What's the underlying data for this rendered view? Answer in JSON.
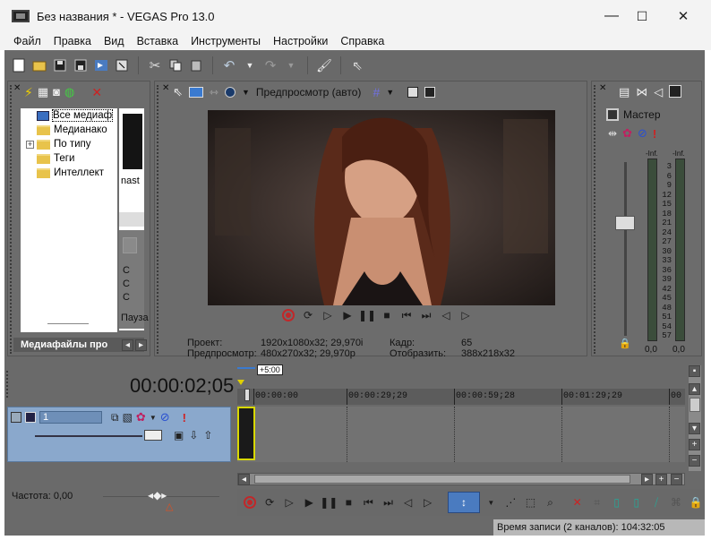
{
  "window": {
    "title": "Без названия * - VEGAS Pro 13.0",
    "minimize": "—",
    "maximize": "☐",
    "close": "✕"
  },
  "menu": [
    "Файл",
    "Правка",
    "Вид",
    "Вставка",
    "Инструменты",
    "Настройки",
    "Справка"
  ],
  "explorer": {
    "items": [
      {
        "label": "Все медиаф",
        "selected": true
      },
      {
        "label": "Медианако"
      },
      {
        "label": "По типу",
        "expander": "+"
      },
      {
        "label": "Теги"
      },
      {
        "label": "Интеллект"
      }
    ],
    "thumb_name": "nast",
    "pause_label": "Пауза",
    "tab_label": "Медиафайлы про",
    "mark_c": [
      "С",
      "С",
      "С"
    ]
  },
  "preview": {
    "mode_label": "Предпросмотр (авто)",
    "project_label": "Проект:",
    "project_value": "1920x1080x32; 29,970i",
    "preview_label": "Предпросмотр:",
    "preview_value": "480x270x32; 29,970p",
    "frame_label": "Кадр:",
    "frame_value": "65",
    "display_label": "Отобразить:",
    "display_value": "388x218x32"
  },
  "master": {
    "label": "Мастер",
    "scale": [
      "3",
      "6",
      "9",
      "12",
      "15",
      "18",
      "21",
      "24",
      "27",
      "30",
      "33",
      "36",
      "39",
      "42",
      "45",
      "48",
      "51",
      "54",
      "57"
    ],
    "peak_left": "-Inf.",
    "peak_right": "-Inf.",
    "level_left": "0,0",
    "level_right": "0,0"
  },
  "timeline": {
    "timecode": "00:00:02;05",
    "track_number": "1",
    "region_label": "+5:00",
    "ruler": [
      "00:00:00",
      "00:00:29;29",
      "00:00:59;28",
      "00:01:29;29",
      "00"
    ],
    "rate_label": "Частота: 0,00",
    "status": "Время записи (2 каналов): 104:32:05"
  },
  "colors": {
    "app_bg": "#6a6a6a",
    "track_header": "#8aa8cc",
    "clip_border": "#d8d800",
    "record_red": "#c0282a"
  }
}
